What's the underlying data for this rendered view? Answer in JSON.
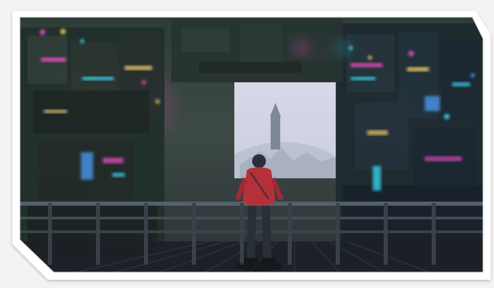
{
  "image": {
    "subject": "person-on-balcony-overlooking-neon-city",
    "frame_style": "white-polygon-frame",
    "colors": {
      "frame": "#ffffff",
      "sky": "#d9dbe0",
      "neon_pink": "#ff4fd2",
      "neon_cyan": "#37e4ff",
      "neon_yellow": "#ffd36a",
      "neon_blue": "#4da3ff",
      "jacket_red": "#b5313a",
      "pants": "#2a2e36"
    }
  }
}
